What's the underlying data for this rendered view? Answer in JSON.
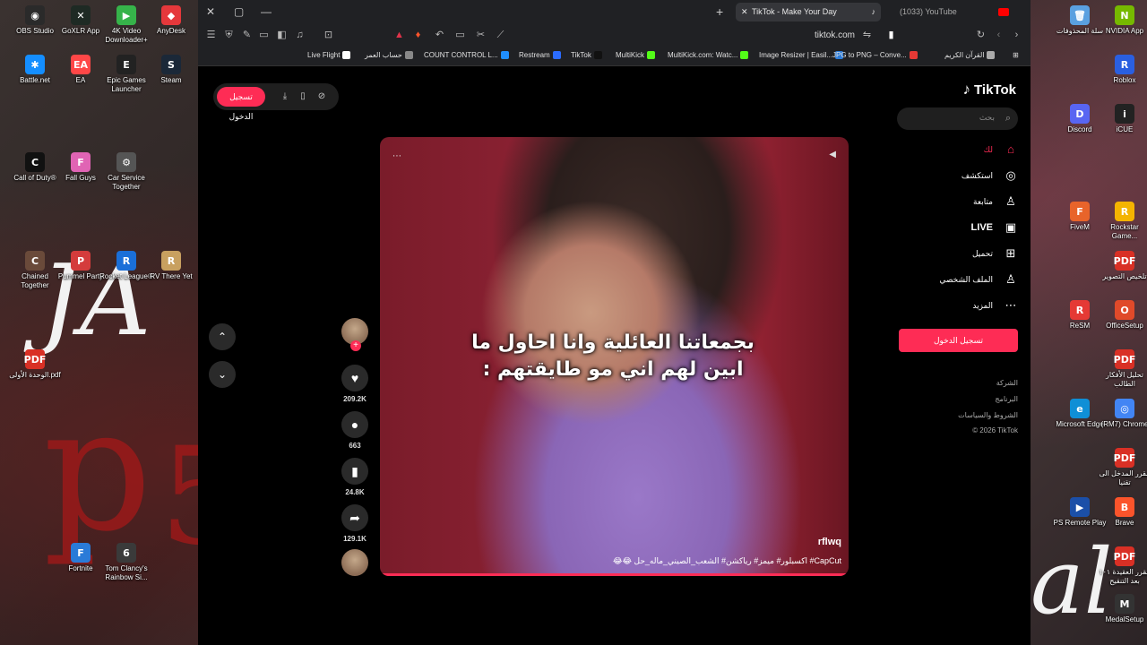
{
  "desktop_left": {
    "icons": [
      {
        "label": "OBS Studio",
        "color": "#2a2a2a",
        "glyph": "◉"
      },
      {
        "label": "GoXLR App",
        "color": "#1e2a24",
        "glyph": "✕"
      },
      {
        "label": "4K Video Downloader+",
        "color": "#36b34a",
        "glyph": "▶"
      },
      {
        "label": "AnyDesk",
        "color": "#e5383b",
        "glyph": "◆"
      },
      {
        "label": "Battle.net",
        "color": "#148eff",
        "glyph": "✱"
      },
      {
        "label": "EA",
        "color": "#ff4747",
        "glyph": "EA"
      },
      {
        "label": "Epic Games Launcher",
        "color": "#222222",
        "glyph": "E"
      },
      {
        "label": "Steam",
        "color": "#1b2838",
        "glyph": "S"
      },
      {
        "label": "Call of Duty®",
        "color": "#111111",
        "glyph": "C"
      },
      {
        "label": "Fall Guys",
        "color": "#e064b4",
        "glyph": "F"
      },
      {
        "label": "Car Service Together",
        "color": "#555555",
        "glyph": "⚙"
      },
      {
        "label": "Chained Together",
        "color": "#6a4a3a",
        "glyph": "C"
      },
      {
        "label": "Pummel Party",
        "color": "#d43c3c",
        "glyph": "P"
      },
      {
        "label": "Rocket League®",
        "color": "#1a6fd8",
        "glyph": "R"
      },
      {
        "label": "RV There Yet",
        "color": "#c8a060",
        "glyph": "R"
      },
      {
        "label": "الوحدة الأولى.pdf",
        "color": "#d93025",
        "glyph": "PDF"
      },
      {
        "label": "Fortnite",
        "color": "#2a7bd8",
        "glyph": "F"
      },
      {
        "label": "Tom Clancy's Rainbow Si...",
        "color": "#3a3a3a",
        "glyph": "6"
      }
    ],
    "deco_text": "JA"
  },
  "desktop_right": {
    "icons": [
      {
        "label": "سلة المحذوفات",
        "color": "#5aa0e0",
        "glyph": "🗑"
      },
      {
        "label": "NVIDIA App",
        "color": "#76b900",
        "glyph": "N"
      },
      {
        "label": "Roblox",
        "color": "#2a5fe0",
        "glyph": "R"
      },
      {
        "label": "Discord",
        "color": "#5865f2",
        "glyph": "D"
      },
      {
        "label": "iCUE",
        "color": "#222222",
        "glyph": "i"
      },
      {
        "label": "FiveM",
        "color": "#e8642a",
        "glyph": "F"
      },
      {
        "label": "Rockstar Game...",
        "color": "#f4b400",
        "glyph": "R"
      },
      {
        "label": "تلخيص التصوير",
        "color": "#d93025",
        "glyph": "PDF"
      },
      {
        "label": "ReSM",
        "color": "#e53935",
        "glyph": "R"
      },
      {
        "label": "OfficeSetup",
        "color": "#e04a2a",
        "glyph": "O"
      },
      {
        "label": "تحليل الأفكار الطالب",
        "color": "#d93025",
        "glyph": "PDF"
      },
      {
        "label": "Microsoft Edge",
        "color": "#0f8fd6",
        "glyph": "e"
      },
      {
        "label": "(RM7) Chrome",
        "color": "#4285f4",
        "glyph": "◎"
      },
      {
        "label": "مقرر المدخل الى تقنيا",
        "color": "#d93025",
        "glyph": "PDF"
      },
      {
        "label": "PS Remote Play",
        "color": "#1b4fa8",
        "glyph": "▶"
      },
      {
        "label": "Brave",
        "color": "#fb542b",
        "glyph": "B"
      },
      {
        "label": "مقرر العقيدة ١٠١ بعد التنقيح",
        "color": "#d93025",
        "glyph": "PDF"
      },
      {
        "label": "MedalSetup",
        "color": "#333333",
        "glyph": "M"
      }
    ],
    "deco_text": "al"
  },
  "browser": {
    "tabs": [
      {
        "title": "TikTok - Make Your Day",
        "active": true
      },
      {
        "title": "(1033) YouTube",
        "active": false
      }
    ],
    "url": "tiktok.com",
    "bookmarks": [
      {
        "label": "Live Flight",
        "color": "#ffffff"
      },
      {
        "label": "حساب العمر",
        "color": "#888888"
      },
      {
        "label": "COUNT CONTROL L...",
        "color": "#1f8fff"
      },
      {
        "label": "Restream",
        "color": "#2b6cff"
      },
      {
        "label": "TikTok",
        "color": "#111111"
      },
      {
        "label": "MultiKick",
        "color": "#53fc18"
      },
      {
        "label": "MultiKick.com: Watc...",
        "color": "#53fc18"
      },
      {
        "label": "Image Resizer | Easil...",
        "color": "#2b7bd8"
      },
      {
        "label": "JPG to PNG – Conve...",
        "color": "#e53935"
      },
      {
        "label": "القرآن الكريم",
        "color": "#aaaaaa"
      }
    ]
  },
  "tiktok": {
    "logo_text": "TikTok",
    "header_login": "تسجيل الدخول",
    "search_placeholder": "بحث",
    "nav": [
      {
        "label": "لك",
        "icon": "home-icon",
        "active": true
      },
      {
        "label": "استكشف",
        "icon": "compass-icon",
        "active": false
      },
      {
        "label": "متابعة",
        "icon": "following-icon",
        "active": false
      },
      {
        "label": "LIVE",
        "icon": "live-icon",
        "active": false
      },
      {
        "label": "تحميل",
        "icon": "upload-icon",
        "active": false
      },
      {
        "label": "الملف الشخصي",
        "icon": "profile-icon",
        "active": false
      },
      {
        "label": "المزيد",
        "icon": "more-icon",
        "active": false
      }
    ],
    "sidebar_login": "تسجيل الدخول",
    "footer": [
      "الشركة",
      "البرنامج",
      "الشروط والسياسات",
      "© 2026 TikTok"
    ],
    "video": {
      "caption_line1": "بجمعاتنا العائلية وانا احاول ما",
      "caption_line2": "ابين لهم اني مو طايقتهم :",
      "author": "rflwq",
      "description": "CapCut# اكسبلور# ميمز# رياكشن# الشعب_الصيني_ماله_حل 😂😂"
    },
    "actions": {
      "likes": "209.2K",
      "comments": "663",
      "saves": "24.8K",
      "shares": "129.1K"
    }
  }
}
